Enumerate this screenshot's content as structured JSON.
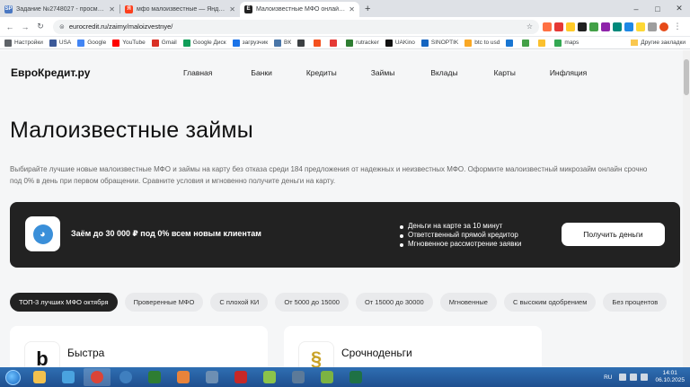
{
  "browser": {
    "tabs": [
      {
        "label": "Задание №2748027 - просмотр з",
        "favicon_text": "SP",
        "favicon_color": "#4a78c2",
        "active": false
      },
      {
        "label": "мфо малоизвестные — Яндекс: на",
        "favicon_text": "Я",
        "favicon_color": "#fc3f1d",
        "active": false
      },
      {
        "label": "Малоизвестные МФО онлайн и н",
        "favicon_text": "Е",
        "favicon_color": "#222222",
        "active": true
      }
    ],
    "new_tab": "+",
    "url": "eurocredit.ru/zaimy/maloizvestnye/",
    "window_controls": [
      "–",
      "□",
      "✕"
    ]
  },
  "bookmarks": {
    "items": [
      {
        "label": "Настройки",
        "color": "#5f6368"
      },
      {
        "label": "USA",
        "color": "#3b5998"
      },
      {
        "label": "Google",
        "color": "#4285f4"
      },
      {
        "label": "YouTube",
        "color": "#ff0000"
      },
      {
        "label": "Gmail",
        "color": "#d93025"
      },
      {
        "label": "Google Диск",
        "color": "#0f9d58"
      },
      {
        "label": "загрузчик",
        "color": "#1a73e8"
      },
      {
        "label": "ВК",
        "color": "#4a76a8"
      },
      {
        "label": "",
        "color": "#3c4043"
      },
      {
        "label": "",
        "color": "#f4511e"
      },
      {
        "label": "",
        "color": "#e53935"
      },
      {
        "label": "rutracker",
        "color": "#2e7d32"
      },
      {
        "label": "UAKino",
        "color": "#111111"
      },
      {
        "label": "SINOPTIK",
        "color": "#1565c0"
      },
      {
        "label": "btc to usd",
        "color": "#f9a825"
      },
      {
        "label": "",
        "color": "#1976d2"
      },
      {
        "label": "",
        "color": "#43a047"
      },
      {
        "label": "",
        "color": "#fbc02d"
      },
      {
        "label": "maps",
        "color": "#34a853"
      }
    ],
    "other_bookmarks": "Другие закладки"
  },
  "site": {
    "logo": "ЕвроКредит.ру",
    "nav": [
      "Главная",
      "Банки",
      "Кредиты",
      "Займы",
      "Вклады",
      "Карты",
      "Инфляция"
    ],
    "title": "Малоизвестные займы",
    "description": "Выбирайте лучшие новые малоизвестные МФО и займы на карту без отказа среди 184 предложения от надежных и неизвестных МФО. Оформите малоизвестный микрозайм онлайн срочно под 0% в день при первом обращении. Сравните условия и мгновенно получите деньги на карту.",
    "promo": {
      "title": "Заём до 30 000 ₽ под 0% всем новым клиентам",
      "bullets": [
        "Деньги на карте за 10 минут",
        "Ответственный прямой кредитор",
        "Мгновенное рассмотрение заявки"
      ],
      "button": "Получить деньги"
    },
    "filters": [
      "ТОП-3 лучших МФО октября",
      "Проверенные МФО",
      "С плохой КИ",
      "От 5000 до 15000",
      "От 15000 до 30000",
      "Мгновенные",
      "С высоким одобрением",
      "Без процентов"
    ],
    "cards": [
      {
        "name": "Быстра",
        "logo_letter": "b"
      },
      {
        "name": "Срочноденьги",
        "logo_letter": "§"
      }
    ]
  },
  "taskbar": {
    "apps": [
      {
        "name": "explorer",
        "color": "#f2c14e"
      },
      {
        "name": "app-w",
        "color": "#4aa3df"
      },
      {
        "name": "chrome",
        "color": "#db4437"
      },
      {
        "name": "app-globe",
        "color": "#3f7fbf"
      },
      {
        "name": "app-excel-green",
        "color": "#2e7d32"
      },
      {
        "name": "media",
        "color": "#e8833a"
      },
      {
        "name": "app-shield",
        "color": "#6d8fb3"
      },
      {
        "name": "app-64",
        "color": "#c62828"
      },
      {
        "name": "app-color",
        "color": "#8bc34a"
      },
      {
        "name": "app-monitor",
        "color": "#5c7a99"
      },
      {
        "name": "app-note",
        "color": "#7cb342"
      },
      {
        "name": "excel",
        "color": "#1e7145"
      }
    ],
    "lang": "RU",
    "time": "14:01",
    "date": "06.10.2025"
  }
}
